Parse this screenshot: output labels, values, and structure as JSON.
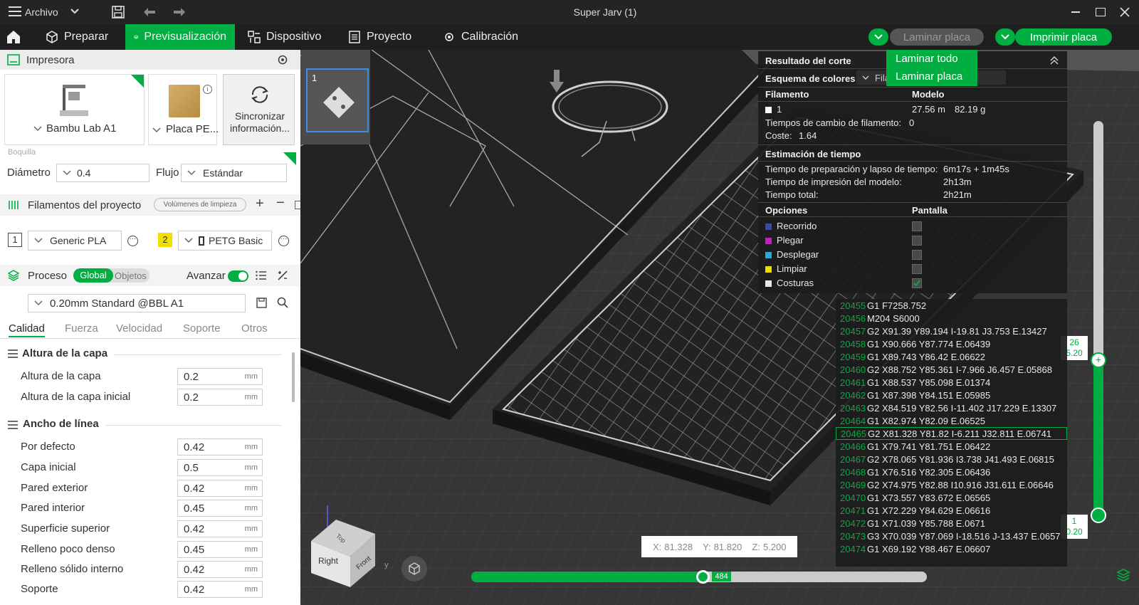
{
  "title": {
    "menu": "Archivo",
    "window": "Super Jarv (1)"
  },
  "tabs": [
    {
      "label": "Preparar"
    },
    {
      "label": "Previsualización"
    },
    {
      "label": "Dispositivo"
    },
    {
      "label": "Proyecto"
    },
    {
      "label": "Calibración"
    }
  ],
  "actions": {
    "slice": "Laminar placa",
    "print": "Imprimir placa"
  },
  "slice_menu": [
    "Laminar todo",
    "Laminar placa"
  ],
  "printer": {
    "header": "Impresora",
    "name": "Bambu Lab A1",
    "plate": "Placa PE...",
    "sync": "Sincronizar información...",
    "nozzle_label": "Boquilla",
    "diameter_label": "Diámetro",
    "diameter": "0.4",
    "flow_label": "Flujo",
    "flow": "Estándar"
  },
  "filaments": {
    "header": "Filamentos del proyecto",
    "purge": "Volúmenes de limpieza",
    "items": [
      {
        "index": "1",
        "name": "Generic PLA"
      },
      {
        "index": "2",
        "name": "PETG Basic"
      }
    ]
  },
  "process": {
    "header": "Proceso",
    "global": "Global",
    "objects": "Objetos",
    "advanced": "Avanzar",
    "profile": "0.20mm Standard @BBL A1",
    "tabs": [
      "Calidad",
      "Fuerza",
      "Velocidad",
      "Soporte",
      "Otros"
    ]
  },
  "settings": {
    "layer_group": "Altura de la capa",
    "layer_rows": [
      {
        "label": "Altura de la capa",
        "value": "0.2",
        "unit": "mm"
      },
      {
        "label": "Altura de la capa inicial",
        "value": "0.2",
        "unit": "mm"
      }
    ],
    "width_group": "Ancho de línea",
    "width_rows": [
      {
        "label": "Por defecto",
        "value": "0.42",
        "unit": "mm"
      },
      {
        "label": "Capa inicial",
        "value": "0.5",
        "unit": "mm"
      },
      {
        "label": "Pared exterior",
        "value": "0.42",
        "unit": "mm"
      },
      {
        "label": "Pared interior",
        "value": "0.45",
        "unit": "mm"
      },
      {
        "label": "Superficie superior",
        "value": "0.42",
        "unit": "mm"
      },
      {
        "label": "Relleno poco denso",
        "value": "0.45",
        "unit": "mm"
      },
      {
        "label": "Relleno sólido interno",
        "value": "0.42",
        "unit": "mm"
      },
      {
        "label": "Soporte",
        "value": "0.42",
        "unit": "mm"
      }
    ]
  },
  "plate_thumb_number": "1",
  "result": {
    "header": "Resultado del corte",
    "scheme_label": "Esquema de colores",
    "scheme_value": "Fila",
    "col_filament": "Filamento",
    "col_model": "Modelo",
    "filament_row": {
      "index": "1",
      "length": "27.56 m",
      "weight": "82.19 g"
    },
    "changes": "Tiempos de cambio de filamento:",
    "changes_val": "0",
    "cost": "Coste:",
    "cost_val": "1.64",
    "time_header": "Estimación de tiempo",
    "prep_label": "Tiempo de preparación y lapso de tiempo:",
    "prep_val": "6m17s + 1m45s",
    "model_time_label": "Tiempo de impresión del modelo:",
    "model_time_val": "2h13m",
    "total_label": "Tiempo total:",
    "total_val": "2h21m",
    "options_header": "Opciones",
    "display_header": "Pantalla",
    "options": [
      {
        "label": "Recorrido",
        "color": "#3f4aa5",
        "checked": false
      },
      {
        "label": "Plegar",
        "color": "#c020c0",
        "checked": false
      },
      {
        "label": "Desplegar",
        "color": "#2aa8d8",
        "checked": false
      },
      {
        "label": "Limpiar",
        "color": "#e8e000",
        "checked": false
      },
      {
        "label": "Costuras",
        "color": "#e8e8e8",
        "checked": true
      }
    ]
  },
  "gcode": [
    {
      "n": "20455",
      "c": "G1 F7258.752"
    },
    {
      "n": "20456",
      "c": "M204 S6000"
    },
    {
      "n": "20457",
      "c": "G2 X91.39 Y89.194 I-19.81 J3.753 E.13427"
    },
    {
      "n": "20458",
      "c": "G1 X90.666 Y87.774 E.06439"
    },
    {
      "n": "20459",
      "c": "G1 X89.743 Y86.42 E.06622"
    },
    {
      "n": "20460",
      "c": "G2 X88.752 Y85.361 I-7.966 J6.457 E.05868"
    },
    {
      "n": "20461",
      "c": "G1 X88.537 Y85.098 E.01374"
    },
    {
      "n": "20462",
      "c": "G1 X87.398 Y84.151 E.05985"
    },
    {
      "n": "20463",
      "c": "G2 X84.519 Y82.56 I-11.402 J17.229 E.13307"
    },
    {
      "n": "20464",
      "c": "G1 X82.974 Y82.09 E.06525"
    },
    {
      "n": "20465",
      "c": "G2 X81.328 Y81.82 I-6.211 J32.811 E.06741"
    },
    {
      "n": "20466",
      "c": "G1 X79.741 Y81.751 E.06422"
    },
    {
      "n": "20467",
      "c": "G2 X78.065 Y81.936 I3.738 J41.493 E.06815"
    },
    {
      "n": "20468",
      "c": "G1 X76.516 Y82.305 E.06436"
    },
    {
      "n": "20469",
      "c": "G2 X74.975 Y82.88 I10.916 J31.611 E.06646"
    },
    {
      "n": "20470",
      "c": "G1 X73.557 Y83.672 E.06565"
    },
    {
      "n": "20471",
      "c": "G1 X72.229 Y84.629 E.06616"
    },
    {
      "n": "20472",
      "c": "G1 X71.039 Y85.788 E.0671"
    },
    {
      "n": "20473",
      "c": "G3 X70.039 Y87.069 I-18.516 J-13.437 E.0657"
    },
    {
      "n": "20474",
      "c": "G1 X69.192 Y88.467 E.06607"
    }
  ],
  "coords": {
    "x_label": "X:",
    "x": "81.328",
    "y_label": "Y:",
    "y": "81.820",
    "z_label": "Z:",
    "z": "5.200"
  },
  "hslider": {
    "value": "484",
    "fraction": 0.51
  },
  "vslider": {
    "top_layer": "26",
    "top_height": "5.20",
    "bottom_layer": "1",
    "bottom_height": "0.20"
  },
  "cube_labels": {
    "front": "Right",
    "side": "Front",
    "top": "Top"
  },
  "colors": {
    "accent": "#00ae42",
    "filament2": "#f0e000"
  }
}
